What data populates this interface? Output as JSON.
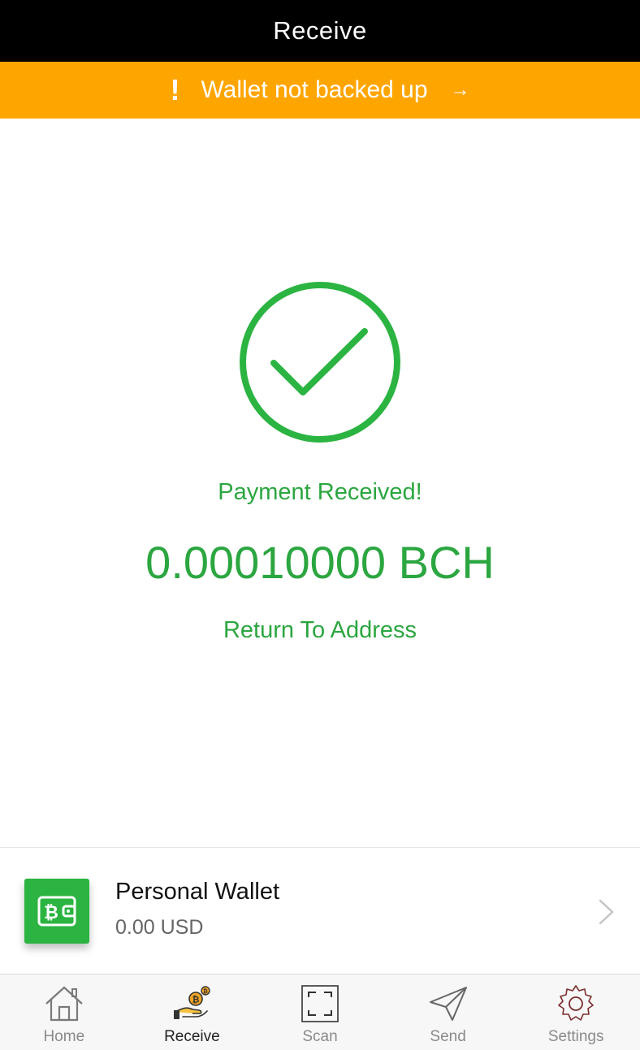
{
  "header": {
    "title": "Receive"
  },
  "banner": {
    "warning_glyph": "!",
    "text": "Wallet not backed up",
    "arrow": "→",
    "color": "#FFA500"
  },
  "payment": {
    "icon": "checkmark-circle-icon",
    "title": "Payment Received!",
    "amount": "0.00010000 BCH",
    "return_label": "Return To Address",
    "color": "#2BA640"
  },
  "wallet": {
    "icon": "bitcoin-wallet-icon",
    "name": "Personal Wallet",
    "balance": "0.00 USD",
    "color": "#2BB441"
  },
  "tabs": [
    {
      "label": "Home",
      "icon": "home-icon",
      "active": false
    },
    {
      "label": "Receive",
      "icon": "receive-coin-hand-icon",
      "active": true
    },
    {
      "label": "Scan",
      "icon": "scan-frame-icon",
      "active": false
    },
    {
      "label": "Send",
      "icon": "send-paper-plane-icon",
      "active": false
    },
    {
      "label": "Settings",
      "icon": "gear-icon",
      "active": false
    }
  ]
}
